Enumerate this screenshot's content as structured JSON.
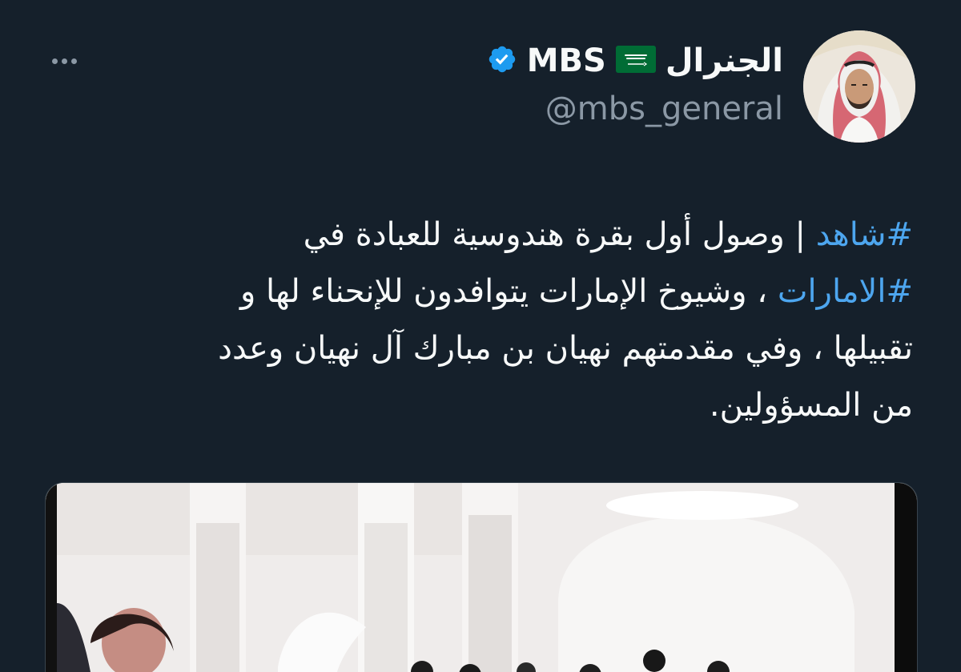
{
  "header": {
    "display_name_arabic": "الجنرال",
    "flag": "saudi-flag",
    "display_name_latin": "MBS",
    "verified": "verified-badge-icon",
    "handle": "@mbs_general"
  },
  "tweet": {
    "hashtag_1": "#شاهد",
    "line_1_rest": " | وصول أول بقرة هندوسية للعبادة في",
    "hashtag_2": "#الامارات",
    "line_2_rest": " ، وشيوخ الإمارات يتوافدون للإنحناء لها و",
    "line_3": "تقبيلها ، وفي مقدمتهم نهيان بن مبارك آل نهيان وعدد",
    "line_4": "من المسؤولين."
  },
  "colors": {
    "background": "#15202b",
    "text": "#f7f9f9",
    "secondary": "#8b98a5",
    "link": "#4da6ef",
    "verified": "#1d9bf0",
    "flag_green": "#006c35"
  }
}
